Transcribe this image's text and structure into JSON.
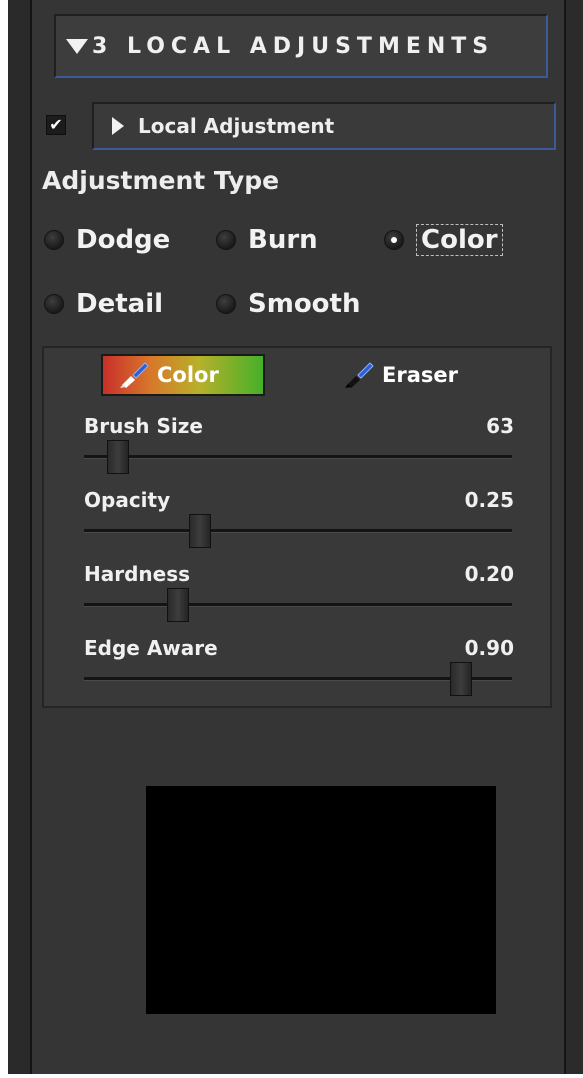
{
  "section": {
    "title": "3 LOCAL ADJUSTMENTS"
  },
  "local_adjustment": {
    "checked": true,
    "check_glyph": "✔",
    "label": "Local Adjustment"
  },
  "adjustment_type": {
    "label": "Adjustment Type",
    "options": [
      {
        "label": "Dodge",
        "selected": false
      },
      {
        "label": "Burn",
        "selected": false
      },
      {
        "label": "Color",
        "selected": true
      },
      {
        "label": "Detail",
        "selected": false
      },
      {
        "label": "Smooth",
        "selected": false
      }
    ]
  },
  "brush": {
    "tools": {
      "color_label": "Color",
      "eraser_label": "Eraser",
      "active": "Color"
    },
    "sliders": [
      {
        "label": "Brush Size",
        "value": "63",
        "fraction": 0.08
      },
      {
        "label": "Opacity",
        "value": "0.25",
        "fraction": 0.27
      },
      {
        "label": "Hardness",
        "value": "0.20",
        "fraction": 0.22
      },
      {
        "label": "Edge Aware",
        "value": "0.90",
        "fraction": 0.88
      }
    ]
  },
  "colors": {
    "panel_bg": "#353535",
    "accent_border": "#3a5a9a",
    "preview_bg": "#000000"
  },
  "icons": {
    "disclosure_open": "triangle-down-icon",
    "disclosure_closed": "triangle-right-icon",
    "brush": "paintbrush-icon"
  }
}
